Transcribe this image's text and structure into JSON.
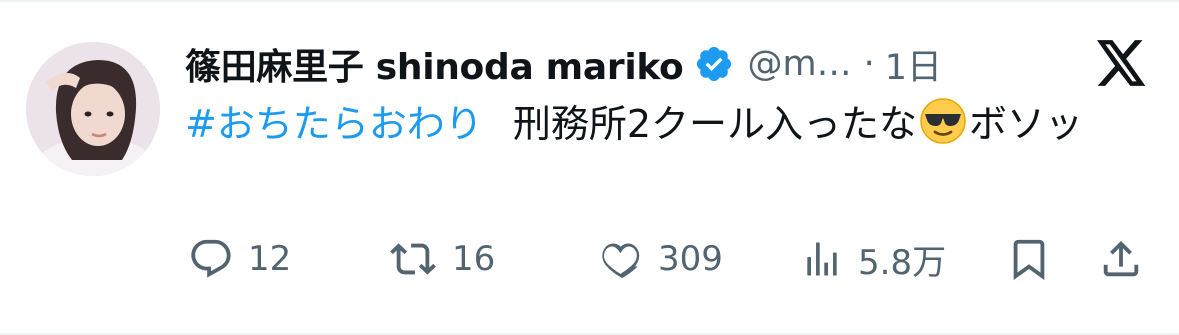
{
  "author": {
    "display_name": "篠田麻里子 shinoda mariko",
    "verified": true,
    "handle": "@m…",
    "separator": "·",
    "timestamp": "1日"
  },
  "platform": {
    "logo_icon": "x-logo-icon"
  },
  "tweet": {
    "hashtag": "#おちたらおわり",
    "text_before_emoji": "刑務所2クール入ったな",
    "emoji": "smiling-face-with-sunglasses",
    "text_after_emoji": "ボソッ"
  },
  "actions": {
    "reply": {
      "icon": "reply-icon",
      "count": "12"
    },
    "repost": {
      "icon": "repost-icon",
      "count": "16"
    },
    "like": {
      "icon": "heart-icon",
      "count": "309"
    },
    "views": {
      "icon": "views-icon",
      "count": "5.8万"
    },
    "bookmark": {
      "icon": "bookmark-icon"
    },
    "share": {
      "icon": "share-icon"
    }
  },
  "colors": {
    "text": "#0f1419",
    "secondary": "#536471",
    "link": "#1d9bf0",
    "verified": "#1d9bf0"
  }
}
